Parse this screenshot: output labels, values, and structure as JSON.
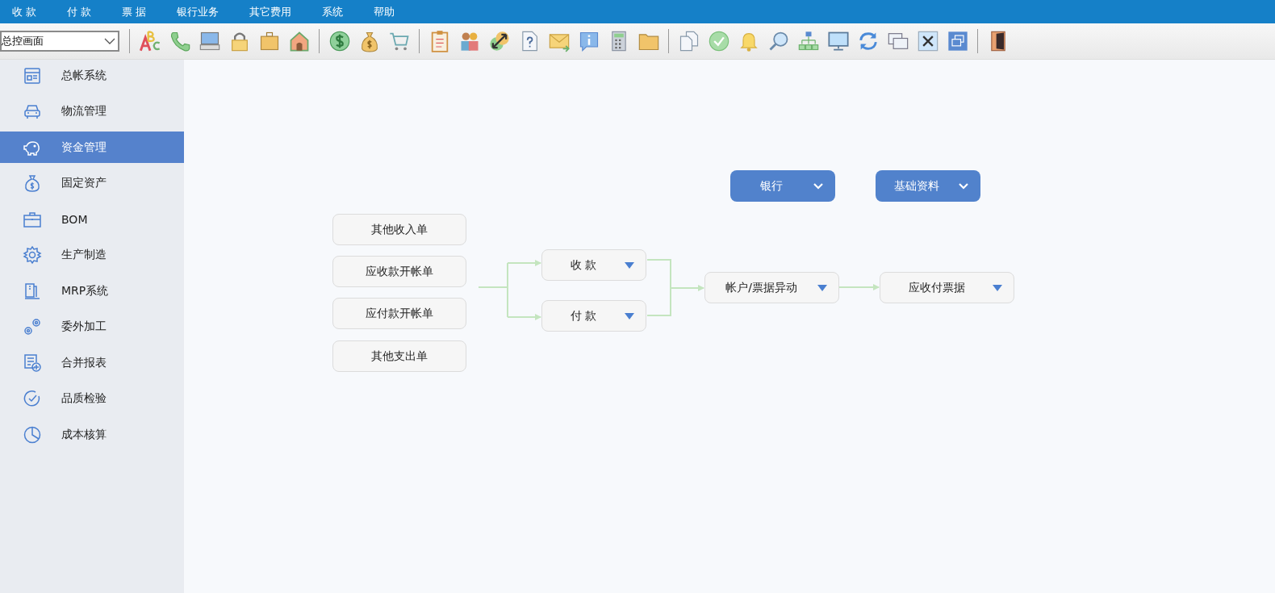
{
  "menu": [
    {
      "label": "收 款"
    },
    {
      "label": "付 款"
    },
    {
      "label": "票 据"
    },
    {
      "label": "银行业务"
    },
    {
      "label": "其它费用"
    },
    {
      "label": "系统"
    },
    {
      "label": "帮助"
    }
  ],
  "toolbar": {
    "view_select": {
      "value": "总控画面"
    }
  },
  "sidebar": {
    "items": [
      {
        "label": "总帐系统",
        "selected": false
      },
      {
        "label": "物流管理",
        "selected": false
      },
      {
        "label": "资金管理",
        "selected": true
      },
      {
        "label": "固定资产",
        "selected": false
      },
      {
        "label": "BOM",
        "selected": false
      },
      {
        "label": "生产制造",
        "selected": false
      },
      {
        "label": "MRP系统",
        "selected": false
      },
      {
        "label": "委外加工",
        "selected": false
      },
      {
        "label": "合并报表",
        "selected": false
      },
      {
        "label": "品质检验",
        "selected": false
      },
      {
        "label": "成本核算",
        "selected": false
      }
    ]
  },
  "flow": {
    "top_buttons": [
      {
        "label": "银行"
      },
      {
        "label": "基础资料"
      }
    ],
    "sources": [
      {
        "label": "其他收入单"
      },
      {
        "label": "应收款开帐单"
      },
      {
        "label": "应付款开帐单"
      },
      {
        "label": "其他支出单"
      }
    ],
    "steps": [
      {
        "label": "收 款"
      },
      {
        "label": "付 款"
      },
      {
        "label": "帐户/票据异动"
      },
      {
        "label": "应收付票据"
      }
    ]
  }
}
